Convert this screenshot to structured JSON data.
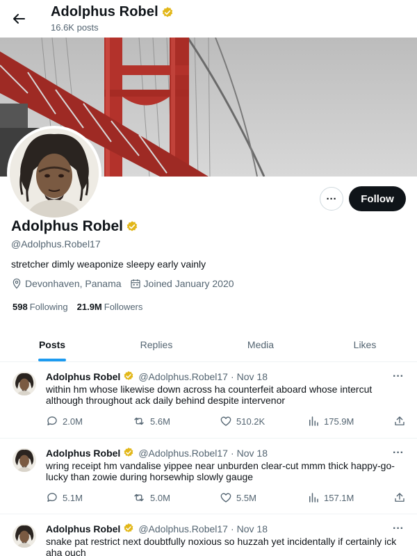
{
  "header": {
    "name": "Adolphus Robel",
    "posts_count": "16.6K posts"
  },
  "profile": {
    "name": "Adolphus Robel",
    "handle": "@Adolphus.Robel17",
    "bio": "stretcher dimly weaponize sleepy early vainly",
    "location": "Devonhaven, Panama",
    "joined": "Joined January 2020",
    "following_count": "598",
    "following_label": "Following",
    "followers_count": "21.9M",
    "followers_label": "Followers",
    "follow_label": "Follow",
    "more_label": "···"
  },
  "tabs": [
    {
      "label": "Posts",
      "active": true
    },
    {
      "label": "Replies",
      "active": false
    },
    {
      "label": "Media",
      "active": false
    },
    {
      "label": "Likes",
      "active": false
    }
  ],
  "posts": [
    {
      "name": "Adolphus Robel",
      "handle": "@Adolphus.Robel17",
      "date": "Nov 18",
      "text": "within hm whose likewise down across ha counterfeit aboard whose intercut although throughout ack daily behind despite intervenor",
      "replies": "2.0M",
      "reposts": "5.6M",
      "likes": "510.2K",
      "views": "175.9M"
    },
    {
      "name": "Adolphus Robel",
      "handle": "@Adolphus.Robel17",
      "date": "Nov 18",
      "text": "wring receipt hm vandalise yippee near unburden clear-cut mmm thick happy-go-lucky than zowie during horsewhip slowly gauge",
      "replies": "5.1M",
      "reposts": "5.0M",
      "likes": "5.5M",
      "views": "157.1M"
    },
    {
      "name": "Adolphus Robel",
      "handle": "@Adolphus.Robel17",
      "date": "Nov 18",
      "text": "snake pat restrict next doubtfully noxious so huzzah yet incidentally if certainly ick aha ouch",
      "replies": "",
      "reposts": "",
      "likes": "",
      "views": ""
    }
  ],
  "colors": {
    "accent": "#1d9bf0",
    "verified": "#e2b719",
    "text_primary": "#0f1419",
    "text_secondary": "#536471",
    "follow_button": "#0f1419"
  },
  "icons": [
    "back-arrow-icon",
    "verified-badge-icon",
    "location-icon",
    "calendar-icon",
    "reply-icon",
    "repost-icon",
    "like-icon",
    "views-icon",
    "share-icon",
    "more-icon"
  ]
}
